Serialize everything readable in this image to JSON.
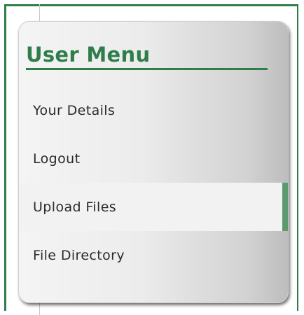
{
  "menu": {
    "title": "User Menu",
    "items": [
      {
        "label": "Your Details",
        "active": false
      },
      {
        "label": "Logout",
        "active": false
      },
      {
        "label": "Upload Files",
        "active": true
      },
      {
        "label": "File Directory",
        "active": false
      }
    ]
  },
  "colors": {
    "accent": "#2e7d4a",
    "active_marker": "#5c9a6e",
    "text": "#2b2b2b"
  }
}
